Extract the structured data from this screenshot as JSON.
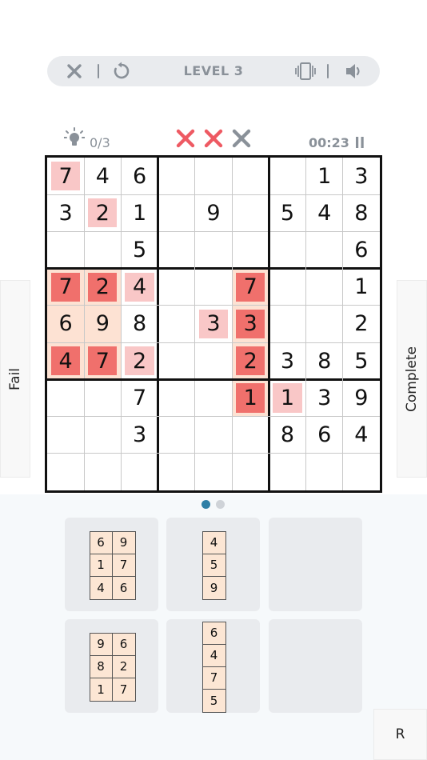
{
  "topbar": {
    "level_label": "LEVEL 3"
  },
  "status": {
    "hints": "0/3",
    "timer": "00:23",
    "mistakes": [
      true,
      true,
      false
    ]
  },
  "buttons": {
    "fail": "Fail",
    "complete": "Complete",
    "r": "R"
  },
  "colors": {
    "light_pink": "#f9c7c7",
    "red": "#f0706c",
    "peach": "#fde2d3",
    "mistake_active": "#ee5a63",
    "mistake_inactive": "#8a9199",
    "icon_grey": "#8a9199",
    "dot_active": "#2e7fa6",
    "dot_inactive": "#cfd3d8"
  },
  "board": {
    "rows": [
      [
        "7",
        "4",
        "6",
        "",
        "",
        "",
        "",
        "1",
        "3"
      ],
      [
        "3",
        "2",
        "1",
        "",
        "9",
        "",
        "5",
        "4",
        "8"
      ],
      [
        "",
        "",
        "5",
        "",
        "",
        "",
        "",
        "",
        "6"
      ],
      [
        "7",
        "2",
        "4",
        "",
        "",
        "7",
        "",
        "",
        "1"
      ],
      [
        "6",
        "9",
        "8",
        "",
        "3",
        "3",
        "",
        "",
        "2"
      ],
      [
        "4",
        "7",
        "2",
        "",
        "",
        "2",
        "3",
        "8",
        "5"
      ],
      [
        "",
        "",
        "7",
        "",
        "",
        "1",
        "1",
        "3",
        "9"
      ],
      [
        "",
        "",
        "3",
        "",
        "",
        "",
        "8",
        "6",
        "4"
      ],
      [
        "",
        "",
        "",
        "",
        "",
        "",
        "",
        "",
        ""
      ]
    ],
    "highlights": [
      [
        0,
        0,
        "light"
      ],
      [
        1,
        1,
        "light"
      ],
      [
        3,
        0,
        "red"
      ],
      [
        3,
        1,
        "red"
      ],
      [
        3,
        2,
        "light"
      ],
      [
        3,
        5,
        "red"
      ],
      [
        4,
        0,
        "peach"
      ],
      [
        4,
        1,
        "peach"
      ],
      [
        4,
        4,
        "light"
      ],
      [
        4,
        5,
        "red"
      ],
      [
        5,
        0,
        "red"
      ],
      [
        5,
        1,
        "red"
      ],
      [
        5,
        2,
        "light"
      ],
      [
        5,
        5,
        "red"
      ],
      [
        6,
        5,
        "red"
      ],
      [
        6,
        6,
        "light"
      ]
    ],
    "peach_block": [
      [
        3,
        0
      ],
      [
        3,
        1
      ],
      [
        4,
        0
      ],
      [
        4,
        1
      ],
      [
        5,
        0
      ],
      [
        5,
        1
      ],
      [
        3,
        5
      ],
      [
        4,
        5
      ],
      [
        5,
        5
      ],
      [
        6,
        5
      ]
    ]
  },
  "pager": {
    "pages": 2,
    "active": 0
  },
  "tray": {
    "slots": [
      {
        "cols": 2,
        "cells": [
          "6",
          "9",
          "1",
          "7",
          "4",
          "6"
        ]
      },
      {
        "cols": 1,
        "cells": [
          "4",
          "5",
          "9"
        ]
      },
      {
        "cols": 0,
        "cells": []
      },
      {
        "cols": 2,
        "cells": [
          "9",
          "6",
          "8",
          "2",
          "1",
          "7"
        ]
      },
      {
        "cols": 1,
        "cells": [
          "6",
          "4",
          "7",
          "5"
        ]
      },
      {
        "cols": 0,
        "cells": []
      }
    ]
  }
}
